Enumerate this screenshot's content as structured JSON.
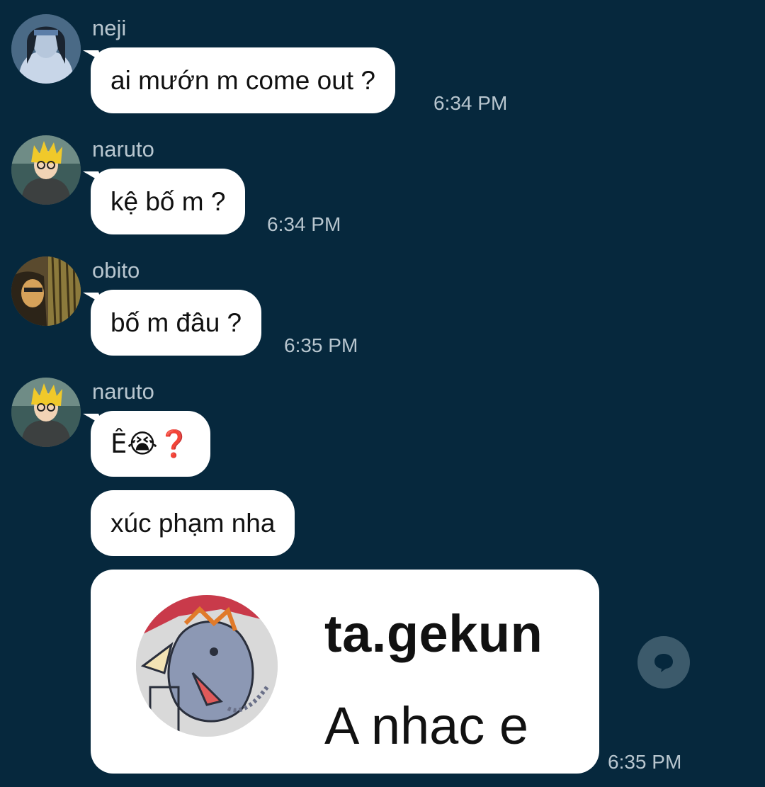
{
  "messages": [
    {
      "sender": "neji",
      "text": "ai mướn m come out ?",
      "time": "6:34 PM"
    },
    {
      "sender": "naruto",
      "text": "kệ bố m ?",
      "time": "6:34 PM"
    },
    {
      "sender": "obito",
      "text": "bố m đâu ?",
      "time": "6:35 PM"
    },
    {
      "sender": "naruto",
      "text": "Ê😭❓",
      "text2": "xúc phạm nha",
      "time": "6:35 PM"
    }
  ],
  "media": {
    "username": "ta.gekun",
    "message": "A nhac e"
  },
  "icons": {
    "share": "chat-bubble-icon"
  },
  "colors": {
    "background": "#06283d",
    "bubble": "#ffffff",
    "meta_text": "#b8c6cf"
  }
}
